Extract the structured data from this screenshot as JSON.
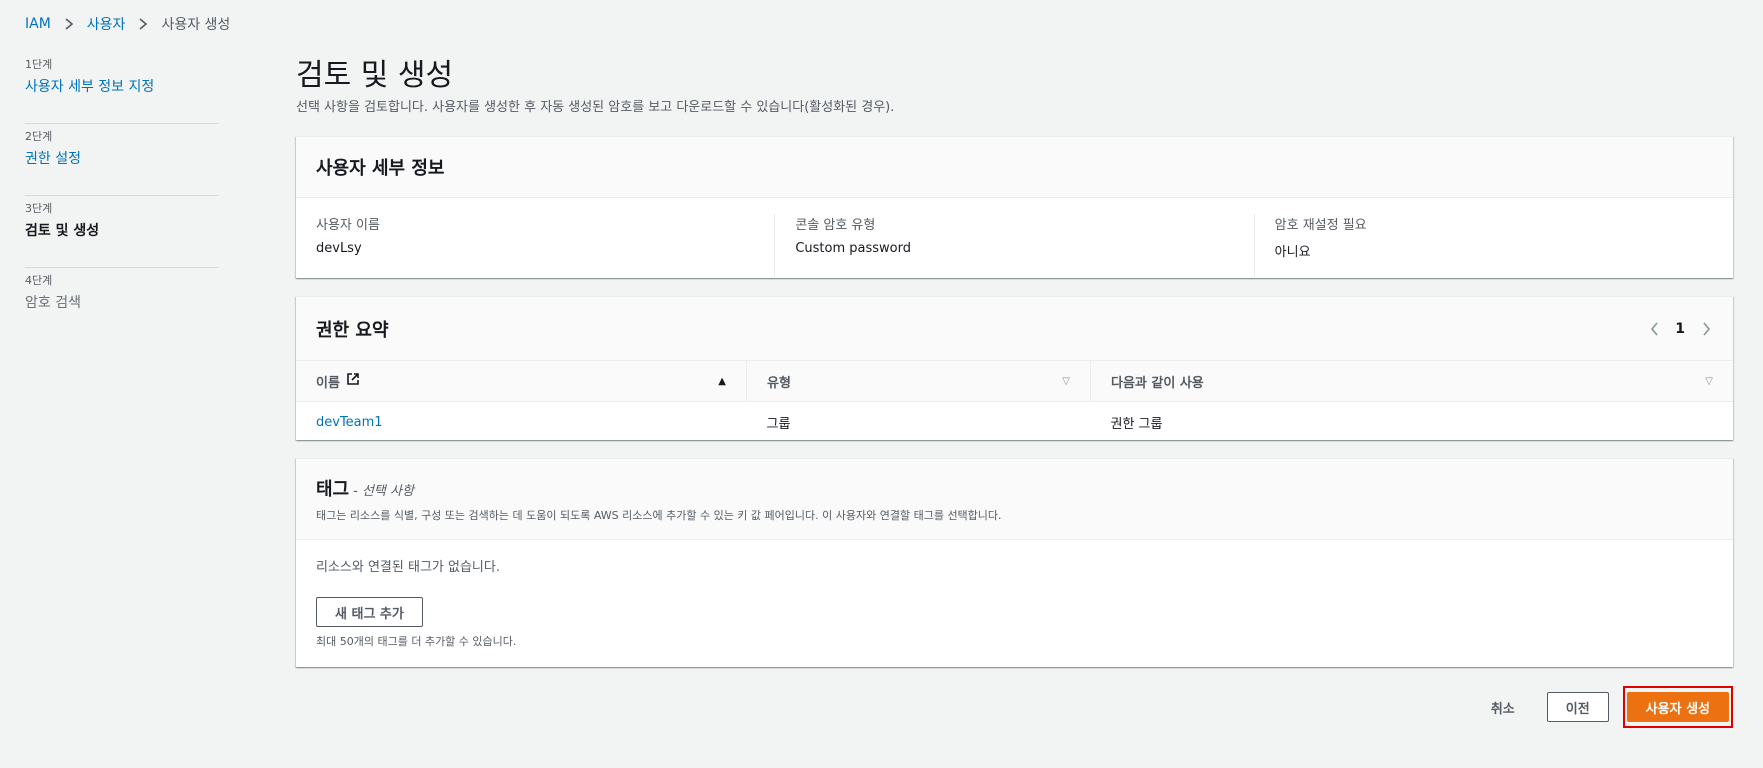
{
  "breadcrumb": {
    "items": [
      "IAM",
      "사용자",
      "사용자 생성"
    ]
  },
  "steps": [
    {
      "num": "1단계",
      "label": "사용자 세부 정보 지정"
    },
    {
      "num": "2단계",
      "label": "권한 설정"
    },
    {
      "num": "3단계",
      "label": "검토 및 생성"
    },
    {
      "num": "4단계",
      "label": "암호 검색"
    }
  ],
  "page": {
    "title": "검토 및 생성",
    "description": "선택 사항을 검토합니다. 사용자를 생성한 후 자동 생성된 암호를 보고 다운로드할 수 있습니다(활성화된 경우)."
  },
  "user_details": {
    "title": "사용자 세부 정보",
    "fields": [
      {
        "key": "사용자 이름",
        "value": "devLsy"
      },
      {
        "key": "콘솔 암호 유형",
        "value": "Custom password"
      },
      {
        "key": "암호 재설정 필요",
        "value": "아니요"
      }
    ]
  },
  "permissions": {
    "title": "권한 요약",
    "page": "1",
    "columns": [
      "이름",
      "유형",
      "다음과 같이 사용"
    ],
    "rows": [
      {
        "name": "devTeam1",
        "type": "그룹",
        "used_as": "권한 그룹"
      }
    ]
  },
  "tags": {
    "title": "태그",
    "optional": "- 선택 사항",
    "description": "태그는 리소스를 식별, 구성 또는 검색하는 데 도움이 되도록 AWS 리소스에 추가할 수 있는 키 값 페어입니다. 이 사용자와 연결할 태그를 선택합니다.",
    "empty": "리소스와 연결된 태그가 없습니다.",
    "add_label": "새 태그 추가",
    "hint": "최대 50개의 태그를 더 추가할 수 있습니다."
  },
  "actions": {
    "cancel": "취소",
    "previous": "이전",
    "create": "사용자 생성"
  },
  "colors": {
    "link": "#0073bb",
    "primary": "#ec7211",
    "highlight": "#e00000"
  }
}
